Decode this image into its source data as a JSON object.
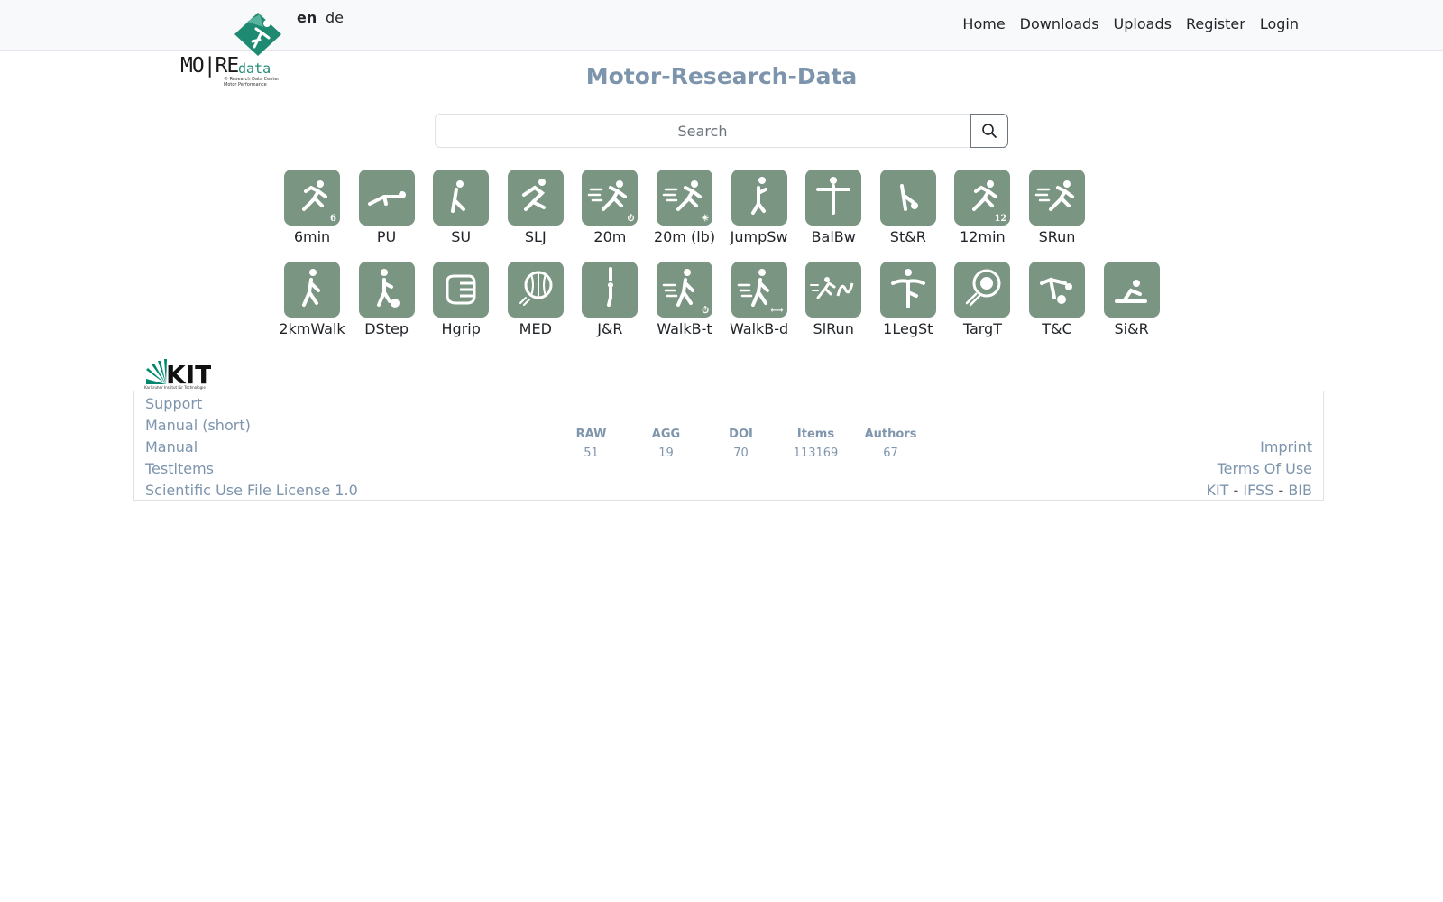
{
  "nav": {
    "languages": [
      {
        "code": "en",
        "active": true
      },
      {
        "code": "de",
        "active": false
      }
    ],
    "links": [
      "Home",
      "Downloads",
      "Uploads",
      "Register",
      "Login"
    ]
  },
  "logo": {
    "word": "MO|RE",
    "sub": "data",
    "tagline_1": "© Research Data Center",
    "tagline_2": "Motor Performance"
  },
  "title": "Motor-Research-Data",
  "search": {
    "placeholder": "Search",
    "value": "",
    "icon": "search-icon"
  },
  "tiles_row1": [
    {
      "label": "6min",
      "icon": "runner-6-icon",
      "badge": "6"
    },
    {
      "label": "PU",
      "icon": "push-up-icon",
      "badge": ""
    },
    {
      "label": "SU",
      "icon": "sit-up-icon",
      "badge": ""
    },
    {
      "label": "SLJ",
      "icon": "long-jump-icon",
      "badge": ""
    },
    {
      "label": "20m",
      "icon": "sprint-timer-icon",
      "badge": "⏱"
    },
    {
      "label": "20m (lb)",
      "icon": "sprint-lightbarrier-icon",
      "badge": "✳"
    },
    {
      "label": "JumpSw",
      "icon": "jump-sideways-icon",
      "badge": ""
    },
    {
      "label": "BalBw",
      "icon": "balance-backward-icon",
      "badge": ""
    },
    {
      "label": "St&R",
      "icon": "stand-and-reach-icon",
      "badge": ""
    },
    {
      "label": "12min",
      "icon": "runner-12-icon",
      "badge": "12"
    },
    {
      "label": "SRun",
      "icon": "shuttle-run-icon",
      "badge": ""
    }
  ],
  "tiles_row2": [
    {
      "label": "2kmWalk",
      "icon": "walk-icon",
      "badge": ""
    },
    {
      "label": "DStep",
      "icon": "step-icon",
      "badge": ""
    },
    {
      "label": "Hgrip",
      "icon": "hand-grip-icon",
      "badge": ""
    },
    {
      "label": "MED",
      "icon": "medicine-ball-icon",
      "badge": ""
    },
    {
      "label": "J&R",
      "icon": "jump-and-reach-icon",
      "badge": ""
    },
    {
      "label": "WalkB-t",
      "icon": "walk-timer-icon",
      "badge": "⏱"
    },
    {
      "label": "WalkB-d",
      "icon": "walk-distance-icon",
      "badge": "⟷"
    },
    {
      "label": "SlRun",
      "icon": "slalom-run-icon",
      "badge": ""
    },
    {
      "label": "1LegSt",
      "icon": "one-leg-stand-icon",
      "badge": ""
    },
    {
      "label": "TargT",
      "icon": "target-throw-icon",
      "badge": ""
    },
    {
      "label": "T&C",
      "icon": "touch-and-catch-icon",
      "badge": ""
    },
    {
      "label": "Si&R",
      "icon": "sit-and-reach-icon",
      "badge": ""
    }
  ],
  "kit_logo": {
    "word": "KIT",
    "caption": "Karlsruher Institut für Technologie"
  },
  "footer": {
    "left_links": [
      "Support",
      "Manual (short)",
      "Manual",
      "Testitems",
      "Scientific Use File License 1.0"
    ],
    "stats": [
      {
        "head": "RAW",
        "value": "51"
      },
      {
        "head": "AGG",
        "value": "19"
      },
      {
        "head": "DOI",
        "value": "70"
      },
      {
        "head": "Items",
        "value": "113169"
      },
      {
        "head": "Authors",
        "value": "67"
      }
    ],
    "right_links": [
      "Imprint",
      "Terms Of Use"
    ],
    "institutions": [
      "KIT",
      "IFSS",
      "BIB"
    ],
    "separator": "-"
  },
  "colors": {
    "accent": "#7d94ad",
    "tile": "#7b9583",
    "logo_green": "#1f8a72"
  }
}
